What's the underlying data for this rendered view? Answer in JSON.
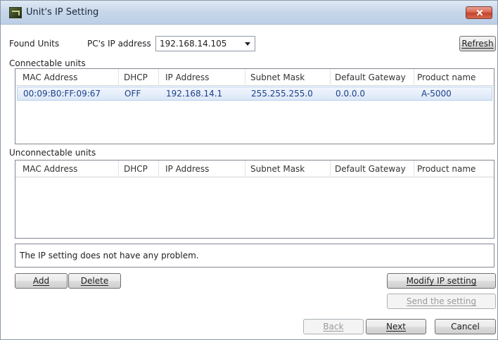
{
  "window": {
    "title": "Unit's IP Setting"
  },
  "header": {
    "found_units_label": "Found Units",
    "pc_ip_label": "PC's IP address",
    "pc_ip_value": "192.168.14.105",
    "refresh_label": "Refresh"
  },
  "connectable": {
    "section_label": "Connectable units",
    "columns": [
      "MAC Address",
      "DHCP",
      "IP Address",
      "Subnet Mask",
      "Default Gateway",
      "Product name"
    ],
    "rows": [
      {
        "mac": "00:09:B0:FF:09:67",
        "dhcp": "OFF",
        "ip": "192.168.14.1",
        "subnet": "255.255.255.0",
        "gateway": "0.0.0.0",
        "product": "A-5000"
      }
    ]
  },
  "unconnectable": {
    "section_label": "Unconnectable units",
    "columns": [
      "MAC Address",
      "DHCP",
      "IP Address",
      "Subnet Mask",
      "Default Gateway",
      "Product name"
    ],
    "rows": []
  },
  "status_message": "The IP setting does not have any problem.",
  "buttons": {
    "add": "Add",
    "delete": "Delete",
    "modify": "Modify IP setting",
    "send": "Send the setting",
    "back": "Back",
    "next": "Next",
    "cancel": "Cancel"
  }
}
